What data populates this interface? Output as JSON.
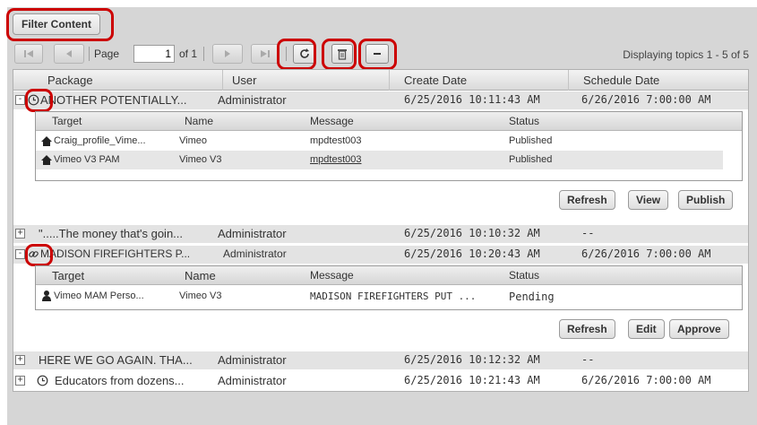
{
  "toolbar": {
    "filter_label": "Filter Content",
    "page_label": "Page",
    "page_value": "1",
    "of_label": "of 1",
    "displaying": "Displaying topics 1 - 5 of 5"
  },
  "columns": [
    "Package",
    "User",
    "Create Date",
    "Schedule Date"
  ],
  "topics": [
    {
      "title": "ANOTHER POTENTIALLY...",
      "user": "Administrator",
      "created": "6/25/2016 10:11:43 AM",
      "scheduled": "6/26/2016 7:00:00 AM",
      "icon": "clock-icon",
      "expanded": true
    },
    {
      "title": "\".....The money that's goin...",
      "user": "Administrator",
      "created": "6/25/2016 10:10:32 AM",
      "scheduled": "--",
      "expanded": false
    },
    {
      "title": "MADISON FIREFIGHTERS P...",
      "user": "Administrator",
      "created": "6/25/2016 10:20:43 AM",
      "scheduled": "6/26/2016 7:00:00 AM",
      "icon": "link-icon",
      "expanded": true
    },
    {
      "title": "HERE WE GO AGAIN. THA...",
      "user": "Administrator",
      "created": "6/25/2016 10:12:32 AM",
      "scheduled": "--",
      "expanded": false
    },
    {
      "title": "Educators from dozens...",
      "user": "Administrator",
      "created": "6/25/2016 10:21:43 AM",
      "scheduled": "6/26/2016 7:00:00 AM",
      "icon": "clock-icon",
      "expanded": false
    }
  ],
  "sub1": {
    "headers": [
      "Target",
      "Name",
      "Message",
      "Status"
    ],
    "rows": [
      {
        "target": "Craig_profile_Vime...",
        "name": "Vimeo",
        "message": "mpdtest003",
        "status": "Published",
        "icon": "home-icon"
      },
      {
        "target": "Vimeo V3 PAM",
        "name": "Vimeo V3",
        "message": "mpdtest003",
        "status": "Published",
        "icon": "home-icon"
      }
    ],
    "buttons": [
      "Refresh",
      "View",
      "Publish"
    ]
  },
  "sub2": {
    "headers": [
      "Target",
      "Name",
      "Message",
      "Status"
    ],
    "rows": [
      {
        "target": "Vimeo MAM Perso...",
        "name": "Vimeo V3",
        "message": "MADISON FIREFIGHTERS PUT ...",
        "status": "Pending",
        "icon": "user-icon"
      }
    ],
    "buttons": [
      "Refresh",
      "Edit",
      "Approve"
    ]
  },
  "colors": {
    "highlight": "#cc0000",
    "panel": "#d6d6d6",
    "link": "#1a33c9"
  }
}
